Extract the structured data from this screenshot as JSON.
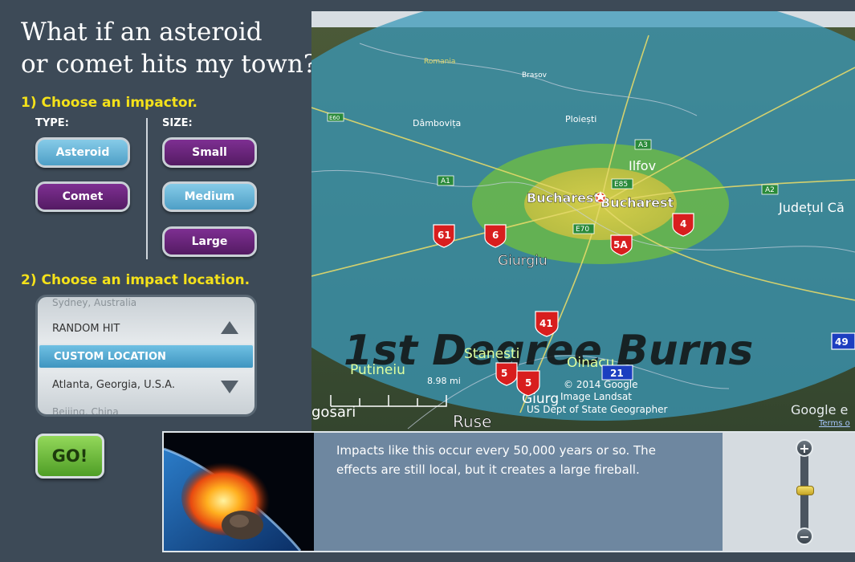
{
  "title": {
    "line1": "What if an asteroid",
    "line2": "or comet hits my town?"
  },
  "step1": {
    "label": "1) Choose an impactor.",
    "type_header": "TYPE:",
    "size_header": "SIZE:",
    "types": [
      "Asteroid",
      "Comet"
    ],
    "sizes": [
      "Small",
      "Medium",
      "Large"
    ],
    "selected_type": "Asteroid",
    "selected_size": "Medium"
  },
  "step2": {
    "label": "2) Choose an impact location.",
    "options": [
      "Sydney, Australia",
      "RANDOM HIT",
      "CUSTOM LOCATION",
      "Atlanta, Georgia, U.S.A.",
      "Beijing, China"
    ],
    "selected": "CUSTOM LOCATION"
  },
  "go_label": "GO!",
  "map": {
    "overlay_text": "1st Degree Burns",
    "places": {
      "romania": "Romania",
      "brasov": "Brașov",
      "dambovita": "Dâmbovița",
      "ploiesti": "Ploiești",
      "ilfov": "Ilfov",
      "bucharest1": "Bucharest",
      "bucharest2": "Bucharest",
      "judetul": "Județul Că",
      "giurgiu": "Giurgiu",
      "stanesti": "Stanesti",
      "oinacu": "Oinacu",
      "putineiu": "Putineiu",
      "giurg": "Giurg",
      "ruse": "Ruse",
      "gosari": "gosari"
    },
    "roads": [
      "A1",
      "A2",
      "A3",
      "E85",
      "E70",
      "E60"
    ],
    "route_shields": [
      "61",
      "6",
      "5A",
      "4",
      "41",
      "5",
      "5",
      "49"
    ],
    "blue_shield": "21",
    "scale_label": "8.98 mi",
    "attribution": [
      "© 2014 Google",
      "Image Landsat",
      "US Dept of State Geographer"
    ],
    "google": "Google e",
    "terms": "Terms o"
  },
  "info": {
    "text": "Impacts like this occur every 50,000 years or so. The effects are still local, but it creates a large fireball.",
    "zoom_plus": "+",
    "zoom_minus": "−"
  }
}
